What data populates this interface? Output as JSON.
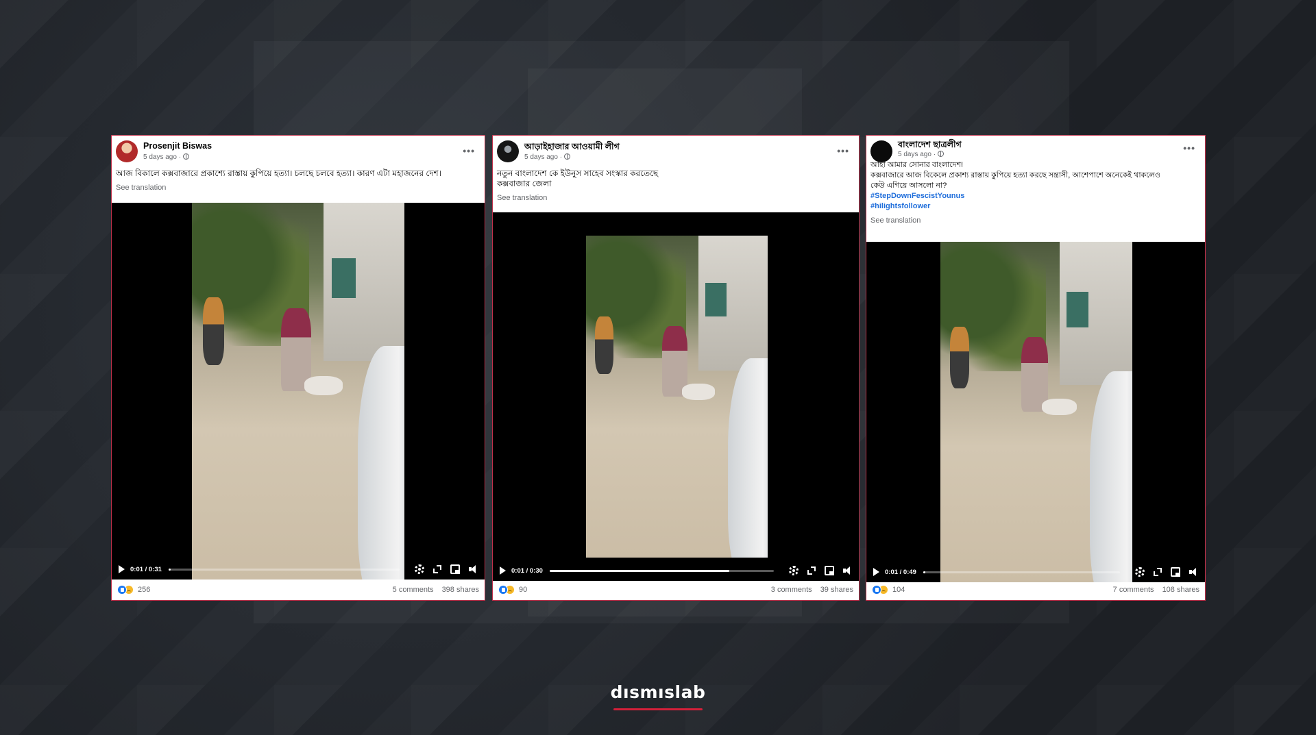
{
  "posts": [
    {
      "author": "Prosenjit Biswas",
      "time": "5 days ago ·",
      "lines": [
        "আজ বিকালে কক্সবাজারে প্রকাশ্যে রাস্তায় কুপিয়ে হত্যা। চলছে চলবে হত্যা। কারণ এটা মহাজনের দেশ।"
      ],
      "hashtags": [],
      "see_translation": "See translation",
      "video_time": "0:01 / 0:31",
      "video_progress": 0.01,
      "reactions": "256",
      "comments": "5 comments",
      "shares": "398 shares"
    },
    {
      "author": "আড়াইহাজার আওয়ামী লীগ",
      "time": "5 days ago ·",
      "lines": [
        "নতুন বাংলাদেশ কে ইউনুস  সাহেব সংস্কার করতেছে",
        "কক্সবাজার জেলা"
      ],
      "hashtags": [],
      "see_translation": "See translation",
      "video_time": "0:01 / 0:30",
      "video_progress": 0.8,
      "reactions": "90",
      "comments": "3 comments",
      "shares": "39 shares"
    },
    {
      "author": "বাংলাদেশ ছাত্রলীগ",
      "time": "5 days ago ·",
      "lines": [
        "আহা আমার সোনার বাংলাদেশ!",
        "কক্সবাজারে আজ বিকেলে প্রকাশ্য রাস্তায় কুপিয়ে হত্যা করছে সন্ত্রাসী, আশেপাশে অনেকেই থাকলেও",
        "কেউ এগিয়ে আসলো না?"
      ],
      "hashtags": [
        "#StepDownFescistYounus",
        "#hilightsfollower"
      ],
      "see_translation": "See translation",
      "video_time": "0:01 / 0:49",
      "video_progress": 0.01,
      "reactions": "104",
      "comments": "7 comments",
      "shares": "108 shares"
    }
  ],
  "brand": "dısmıslab",
  "colors": {
    "post_border": "#c0304a",
    "brand_accent": "#d4203a",
    "background": "#23272d"
  }
}
